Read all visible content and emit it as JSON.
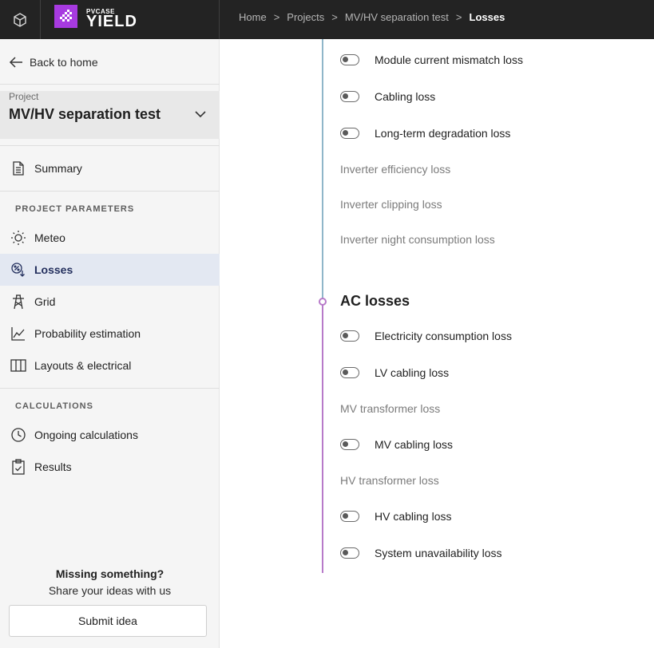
{
  "topbar": {
    "logo_small": "PVCASE",
    "logo_big": "YIELD",
    "breadcrumb": [
      "Home",
      "Projects",
      "MV/HV separation test",
      "Losses"
    ],
    "separator": ">"
  },
  "sidebar": {
    "back_label": "Back to home",
    "project_label": "Project",
    "project_name": "MV/HV separation test",
    "summary_label": "Summary",
    "section_params": "PROJECT PARAMETERS",
    "params_items": [
      {
        "label": "Meteo",
        "icon": "sun-icon"
      },
      {
        "label": "Losses",
        "icon": "losses-icon",
        "active": true
      },
      {
        "label": "Grid",
        "icon": "pylon-icon"
      },
      {
        "label": "Probability estimation",
        "icon": "line-chart-icon"
      },
      {
        "label": "Layouts & electrical",
        "icon": "columns-icon"
      }
    ],
    "section_calcs": "CALCULATIONS",
    "calcs_items": [
      {
        "label": "Ongoing calculations",
        "icon": "clock-icon"
      },
      {
        "label": "Results",
        "icon": "clipboard-check-icon"
      }
    ],
    "missing_title": "Missing something?",
    "missing_subtitle": "Share your ideas with us",
    "submit_label": "Submit idea"
  },
  "main": {
    "dc_losses": [
      {
        "label": "Module current mismatch loss",
        "toggle": true,
        "on": false
      },
      {
        "label": "Cabling loss",
        "toggle": true,
        "on": false
      },
      {
        "label": "Long-term degradation loss",
        "toggle": true,
        "on": false
      },
      {
        "label": "Inverter efficiency loss",
        "toggle": false
      },
      {
        "label": "Inverter clipping loss",
        "toggle": false
      },
      {
        "label": "Inverter night consumption loss",
        "toggle": false
      }
    ],
    "ac_title": "AC losses",
    "ac_losses": [
      {
        "label": "Electricity consumption loss",
        "toggle": true,
        "on": false
      },
      {
        "label": "LV cabling loss",
        "toggle": true,
        "on": false
      },
      {
        "label": "MV transformer loss",
        "toggle": false
      },
      {
        "label": "MV cabling loss",
        "toggle": true,
        "on": false
      },
      {
        "label": "HV transformer loss",
        "toggle": false
      },
      {
        "label": "HV cabling loss",
        "toggle": true,
        "on": false
      },
      {
        "label": "System unavailability loss",
        "toggle": true,
        "on": false
      }
    ]
  },
  "colors": {
    "accent_purple": "#a73ae0",
    "active_nav_bg": "#e3e8f2",
    "timeline_blue": "#8fb6c9",
    "timeline_purple": "#b77ac9"
  }
}
